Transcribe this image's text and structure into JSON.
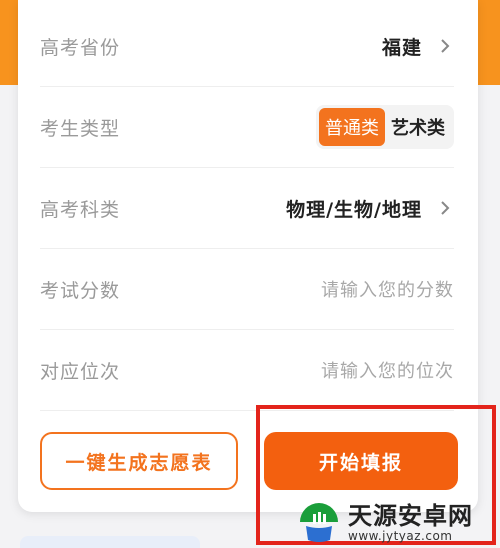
{
  "form": {
    "province": {
      "label": "高考省份",
      "value": "福建"
    },
    "type": {
      "label": "考生类型",
      "options": [
        "普通类",
        "艺术类"
      ],
      "selected": "普通类"
    },
    "subjects": {
      "label": "高考科类",
      "value": "物理/生物/地理"
    },
    "score": {
      "label": "考试分数",
      "placeholder": "请输入您的分数"
    },
    "rank": {
      "label": "对应位次",
      "placeholder": "请输入您的位次"
    }
  },
  "actions": {
    "generate_label": "一键生成志愿表",
    "start_label": "开始填报"
  },
  "watermark": {
    "title": "天源安卓网",
    "url": "www.jytyaz.com"
  },
  "colors": {
    "accent": "#f3731e",
    "primary_button": "#f3600f",
    "highlight_box": "#e3241b",
    "header_band": "#f7931e"
  }
}
